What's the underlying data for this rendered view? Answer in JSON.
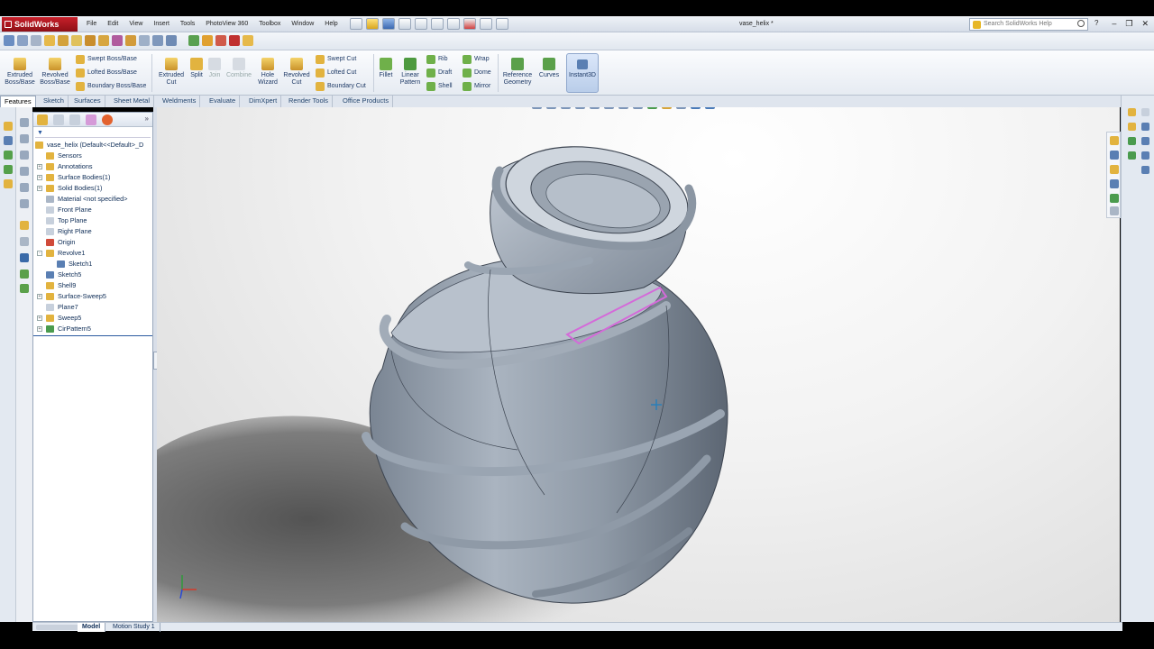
{
  "app": {
    "name": "SolidWorks",
    "document_title": "vase_helix *"
  },
  "menu": [
    "File",
    "Edit",
    "View",
    "Insert",
    "Tools",
    "PhotoView 360",
    "Toolbox",
    "Window",
    "Help"
  ],
  "search": {
    "placeholder": "Search SolidWorks Help"
  },
  "ribbon": {
    "extruded_boss": "Extruded Boss/Base",
    "revolved_boss": "Revolved Boss/Base",
    "swept_boss": "Swept Boss/Base",
    "lofted_boss": "Lofted Boss/Base",
    "boundary_boss": "Boundary Boss/Base",
    "extruded_cut": "Extruded Cut",
    "split": "Split",
    "join": "Join",
    "combine": "Combine",
    "hole_wizard": "Hole Wizard",
    "revolved_cut": "Revolved Cut",
    "swept_cut": "Swept Cut",
    "lofted_cut": "Lofted Cut",
    "boundary_cut": "Boundary Cut",
    "fillet": "Fillet",
    "linear_pattern": "Linear Pattern",
    "rib": "Rib",
    "draft": "Draft",
    "shell": "Shell",
    "wrap": "Wrap",
    "dome": "Dome",
    "mirror": "Mirror",
    "reference_geometry": "Reference Geometry",
    "curves": "Curves",
    "instant3d": "Instant3D"
  },
  "tabs": [
    "Features",
    "Sketch",
    "Surfaces",
    "Sheet Metal",
    "Weldments",
    "Evaluate",
    "DimXpert",
    "Render Tools",
    "Office Products"
  ],
  "tree": [
    {
      "label": "vase_helix  (Default<<Default>_D",
      "icon": "part-icon",
      "level": 0,
      "exp": ""
    },
    {
      "label": "Sensors",
      "icon": "sensors-folder-icon",
      "level": 1,
      "exp": ""
    },
    {
      "label": "Annotations",
      "icon": "annotations-icon",
      "level": 1,
      "exp": "+"
    },
    {
      "label": "Surface Bodies(1)",
      "icon": "surface-bodies-folder-icon",
      "level": 1,
      "exp": "+"
    },
    {
      "label": "Solid Bodies(1)",
      "icon": "solid-bodies-folder-icon",
      "level": 1,
      "exp": "+"
    },
    {
      "label": "Material <not specified>",
      "icon": "material-icon",
      "level": 1,
      "exp": ""
    },
    {
      "label": "Front Plane",
      "icon": "plane-icon",
      "level": 1,
      "exp": ""
    },
    {
      "label": "Top Plane",
      "icon": "plane-icon",
      "level": 1,
      "exp": ""
    },
    {
      "label": "Right Plane",
      "icon": "plane-icon",
      "level": 1,
      "exp": ""
    },
    {
      "label": "Origin",
      "icon": "origin-icon",
      "level": 1,
      "exp": ""
    },
    {
      "label": "Revolve1",
      "icon": "revolve-feature-icon",
      "level": 1,
      "exp": "-"
    },
    {
      "label": "Sketch1",
      "icon": "sketch-icon",
      "level": 2,
      "exp": ""
    },
    {
      "label": "Sketch5",
      "icon": "sketch-icon",
      "level": 1,
      "exp": ""
    },
    {
      "label": "Shell9",
      "icon": "shell-feature-icon",
      "level": 1,
      "exp": ""
    },
    {
      "label": "Surface-Sweep5",
      "icon": "surface-sweep-icon",
      "level": 1,
      "exp": "+"
    },
    {
      "label": "Plane7",
      "icon": "plane-icon",
      "level": 1,
      "exp": ""
    },
    {
      "label": "Sweep5",
      "icon": "sweep-feature-icon",
      "level": 1,
      "exp": "+"
    },
    {
      "label": "CirPattern5",
      "icon": "circular-pattern-icon",
      "level": 1,
      "exp": "+"
    }
  ],
  "bottom_tabs": [
    "Model",
    "Motion Study 1"
  ],
  "colors": {
    "model": "#9ba6b3",
    "highlight": "#d46ad9",
    "accent": "#2b5aa0"
  }
}
